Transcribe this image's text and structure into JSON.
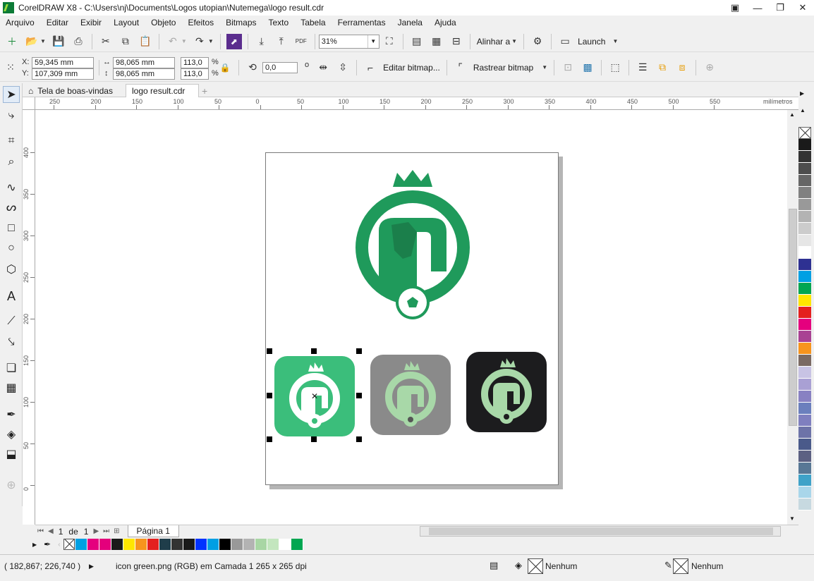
{
  "window": {
    "title": "CorelDRAW X8 - C:\\Users\\nj\\Documents\\Logos utopian\\Nutemega\\logo result.cdr"
  },
  "menu": [
    "Arquivo",
    "Editar",
    "Exibir",
    "Layout",
    "Objeto",
    "Efeitos",
    "Bitmaps",
    "Texto",
    "Tabela",
    "Ferramentas",
    "Janela",
    "Ajuda"
  ],
  "toolbar1": {
    "zoom": "31%",
    "align_label": "Alinhar a",
    "launch_label": "Launch",
    "pdf_label": "PDF"
  },
  "property_bar": {
    "x_label": "X:",
    "x_value": "59,345 mm",
    "y_label": "Y:",
    "y_value": "107,309 mm",
    "width_value": "98,065 mm",
    "height_value": "98,065 mm",
    "scale_w": "113,0",
    "scale_h": "113,0",
    "percent": "%",
    "rotation": "0,0",
    "degree": "o",
    "edit_bitmap": "Editar bitmap...",
    "trace_bitmap": "Rastrear bitmap"
  },
  "doc_tabs": {
    "welcome": "Tela de boas-vindas",
    "active": "logo result.cdr"
  },
  "ruler": {
    "h_labels": [
      "250",
      "200",
      "150",
      "100",
      "50",
      "0",
      "50",
      "100",
      "150",
      "200",
      "250",
      "300",
      "350",
      "400",
      "450",
      "500",
      "550"
    ],
    "h_unit": "milímetros",
    "v_labels": [
      "400",
      "350",
      "300",
      "250",
      "200",
      "150",
      "100",
      "50",
      "0"
    ]
  },
  "page_nav": {
    "current": "1",
    "of": "de",
    "total": "1",
    "page_tab": "Página 1"
  },
  "palette_vertical": [
    "#1a1a1a",
    "#333333",
    "#4d4d4d",
    "#666666",
    "#808080",
    "#999999",
    "#b3b3b3",
    "#cccccc",
    "#e6e6e6",
    "#ffffff",
    "#2e3192",
    "#00a0e3",
    "#00a651",
    "#ffe600",
    "#e4201f",
    "#e5007e",
    "#a94293",
    "#f7941d",
    "#7a6a63",
    "#c8c3e4",
    "#a9a0d4",
    "#8881c2",
    "#6b7fbd",
    "#7f7fbf",
    "#6d73a8",
    "#4a5a8a",
    "#5c6082",
    "#587795",
    "#3fa2c8",
    "#a9d6ea",
    "#c7d9e0"
  ],
  "palette_document": [
    "#00a0e3",
    "#e5007e",
    "#e4007c",
    "#1a1a1a",
    "#ffe600",
    "#f7941d",
    "#e4201f",
    "#1f3d4a",
    "#333333",
    "#1a1a1a",
    "#0033ff",
    "#009fe3",
    "#000000",
    "#999999",
    "#b3b3b3",
    "#a8d6a4",
    "#c3e6be",
    "#ffffff",
    "#00a651"
  ],
  "status": {
    "coords": "( 182,867; 226,740 )",
    "object_info": "icon green.png (RGB) em Camada 1 265 x 265 dpi",
    "fill": "Nenhum",
    "outline": "Nenhum"
  },
  "colors": {
    "logo_green": "#1f9a5b",
    "icon_green": "#3bbe7b",
    "icon_gray": "#8a8a8a",
    "icon_dark": "#1c1c1e",
    "mint": "#a8d8a8"
  }
}
